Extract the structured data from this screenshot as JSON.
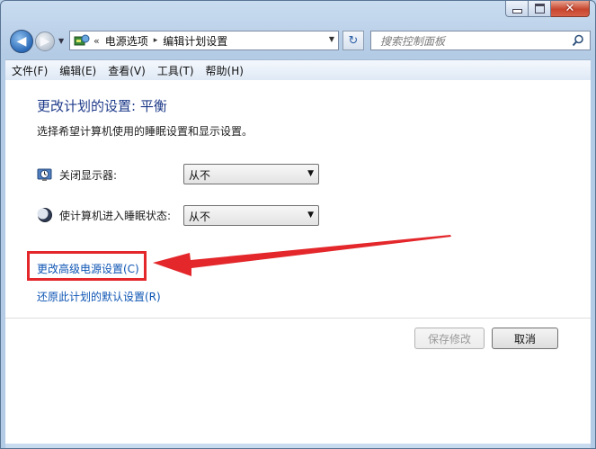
{
  "nav": {
    "breadcrumb_overflow": "«",
    "breadcrumbs": [
      "电源选项",
      "编辑计划设置"
    ],
    "breadcrumb_sep": "▸",
    "search_placeholder": "搜索控制面板"
  },
  "menubar": {
    "items": [
      "文件(F)",
      "编辑(E)",
      "查看(V)",
      "工具(T)",
      "帮助(H)"
    ]
  },
  "content": {
    "title": "更改计划的设置: 平衡",
    "description": "选择希望计算机使用的睡眠设置和显示设置。",
    "display_setting": {
      "label": "关闭显示器:",
      "value": "从不"
    },
    "sleep_setting": {
      "label": "使计算机进入睡眠状态:",
      "value": "从不"
    },
    "advanced_link": "更改高级电源设置(C)",
    "restore_link": "还原此计划的默认设置(R)"
  },
  "buttons": {
    "save": "保存修改",
    "cancel": "取消"
  },
  "icons": {
    "back": "back-arrow-icon",
    "forward": "forward-arrow-icon",
    "control_panel": "control-panel-icon",
    "refresh": "refresh-icon",
    "search": "search-icon",
    "display": "display-timer-icon",
    "sleep": "moon-icon"
  },
  "colors": {
    "title": "#1e3b8a",
    "link": "#0e55b4",
    "annotation": "#e3272b"
  }
}
